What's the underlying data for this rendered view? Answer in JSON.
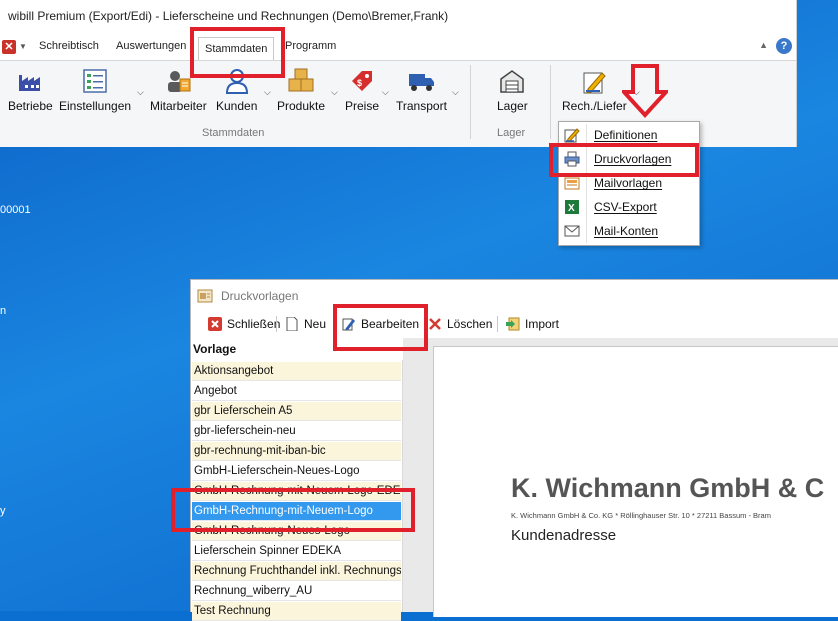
{
  "window": {
    "title": "wibill Premium (Export/Edi) - Lieferscheine und Rechnungen (Demo\\Bremer,Frank)"
  },
  "tabs": [
    "Schreibtisch",
    "Auswertungen",
    "Stammdaten",
    "Programm"
  ],
  "active_tab": "Stammdaten",
  "ribbon": {
    "buttons": [
      "Betriebe",
      "Einstellungen",
      "Mitarbeiter",
      "Kunden",
      "Produkte",
      "Preise",
      "Transport",
      "Lager",
      "Rech./Liefer"
    ],
    "groups": [
      "Stammdaten",
      "Lager"
    ]
  },
  "dropdown_menu": {
    "items": [
      "Definitionen",
      "Druckvorlagen",
      "Mailvorlagen",
      "CSV-Export",
      "Mail-Konten"
    ],
    "highlighted": "Druckvorlagen"
  },
  "desktop_fragments": [
    "00001",
    "n",
    "y"
  ],
  "druckvorlagen": {
    "title": "Druckvorlagen",
    "toolbar": [
      "Schließen",
      "Neu",
      "Bearbeiten",
      "Löschen",
      "Import"
    ],
    "list_header": "Vorlage",
    "rows": [
      "Aktionsangebot",
      "Angebot",
      "gbr Lieferschein A5",
      "gbr-lieferschein-neu",
      "gbr-rechnung-mit-iban-bic",
      "GmbH-Lieferschein-Neues-Logo",
      "GmbH-Rechnung-mit-Neuem-Logo-EDEKA",
      "GmbH-Rechnung-mit-Neuem-Logo",
      "GmbH-Rechnung-Neues-Logo",
      "Lieferschein Spinner EDEKA",
      "Rechnung Fruchthandel inkl. Rechnungsdatum",
      "Rechnung_wiberry_AU",
      "Test Rechnung"
    ],
    "selected_row": "GmbH-Rechnung-mit-Neuem-Logo",
    "preview": {
      "company": "K. Wichmann GmbH & C",
      "address_line": "K. Wichmann GmbH & Co. KG * Röllinghauser Str. 10 * 27211 Bassum - Bram",
      "section": "Kundenadresse"
    }
  },
  "colors": {
    "accent_red": "#e0202a",
    "selection": "#3399ee",
    "row_alt": "#fbf5dc"
  }
}
